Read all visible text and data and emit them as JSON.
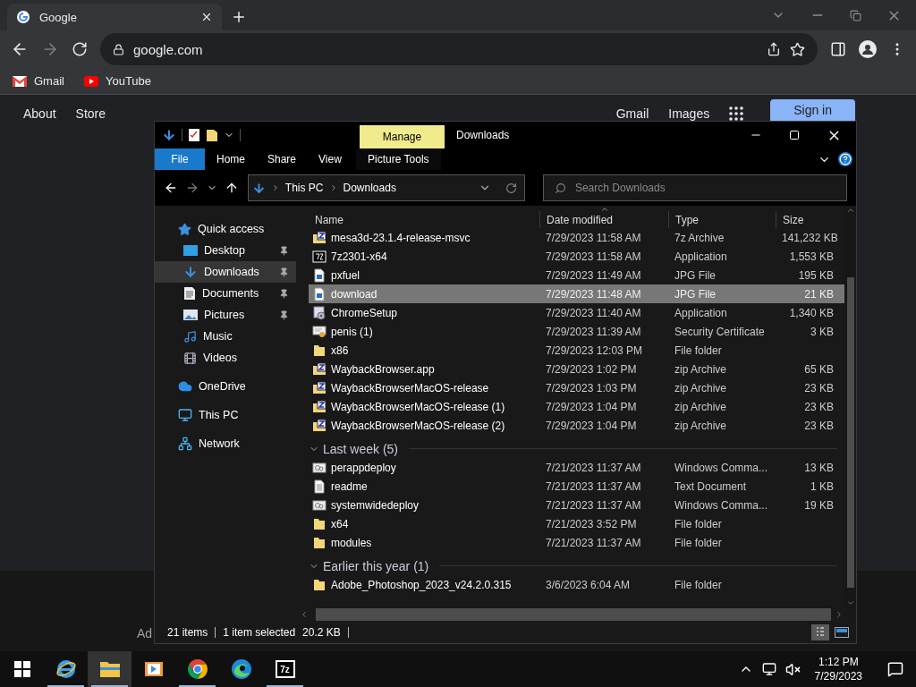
{
  "browser": {
    "tabs": [
      {
        "title": "Google",
        "selected": true
      }
    ],
    "forward_disabled": true,
    "address": "google.com",
    "bookmarks": [
      {
        "label": "Gmail",
        "kind": "gmail"
      },
      {
        "label": "YouTube",
        "kind": "youtube"
      }
    ]
  },
  "page": {
    "left_links": [
      "About",
      "Store"
    ],
    "right_links": [
      "Gmail",
      "Images"
    ],
    "sign_in": "Sign in",
    "footer_text": "Ad"
  },
  "explorer": {
    "title": "Downloads",
    "context_tab": "Manage",
    "ribbon_tabs": [
      {
        "label": "File",
        "kind": "file"
      },
      {
        "label": "Home",
        "kind": "tab"
      },
      {
        "label": "Share",
        "kind": "tab"
      },
      {
        "label": "View",
        "kind": "tab"
      },
      {
        "label": "Picture Tools",
        "kind": "contextual"
      }
    ],
    "forward_disabled": true,
    "breadcrumb": [
      "This PC",
      "Downloads"
    ],
    "search_placeholder": "Search Downloads",
    "nav": [
      {
        "label": "Quick access",
        "kind": "star",
        "selected": false,
        "children": [
          {
            "label": "Desktop",
            "kind": "desktop",
            "pinned": true,
            "selected": false
          },
          {
            "label": "Downloads",
            "kind": "download",
            "pinned": true,
            "selected": true
          },
          {
            "label": "Documents",
            "kind": "documents",
            "pinned": true,
            "selected": false
          },
          {
            "label": "Pictures",
            "kind": "pictures",
            "pinned": true,
            "selected": false
          },
          {
            "label": "Music",
            "kind": "music",
            "pinned": false,
            "selected": false
          },
          {
            "label": "Videos",
            "kind": "videos",
            "pinned": false,
            "selected": false
          }
        ]
      },
      {
        "label": "OneDrive",
        "kind": "cloud",
        "selected": false
      },
      {
        "label": "This PC",
        "kind": "pc",
        "selected": false
      },
      {
        "label": "Network",
        "kind": "network",
        "selected": false
      }
    ],
    "columns": [
      {
        "label": "Name",
        "sorted": false
      },
      {
        "label": "Date modified",
        "sorted": true
      },
      {
        "label": "Type",
        "sorted": false
      },
      {
        "label": "Size",
        "sorted": false
      }
    ],
    "groups": [
      {
        "rows": [
          {
            "name": "mesa3d-23.1.4-release-msvc",
            "date": "7/29/2023 11:58 AM",
            "type": "7z Archive",
            "size": "141,232 KB",
            "kind": "zip",
            "selected": false
          },
          {
            "name": "7z2301-x64",
            "date": "7/29/2023 11:58 AM",
            "type": "Application",
            "size": "1,553 KB",
            "kind": "sevenzip",
            "selected": false
          },
          {
            "name": "pxfuel",
            "date": "7/29/2023 11:49 AM",
            "type": "JPG File",
            "size": "195 KB",
            "kind": "image",
            "selected": false
          },
          {
            "name": "download",
            "date": "7/29/2023 11:48 AM",
            "type": "JPG File",
            "size": "21 KB",
            "kind": "image",
            "selected": true
          },
          {
            "name": "ChromeSetup",
            "date": "7/29/2023 11:40 AM",
            "type": "Application",
            "size": "1,340 KB",
            "kind": "installer",
            "selected": false
          },
          {
            "name": "penis (1)",
            "date": "7/29/2023 11:39 AM",
            "type": "Security Certificate",
            "size": "3 KB",
            "kind": "certificate",
            "selected": false
          },
          {
            "name": "x86",
            "date": "7/29/2023 12:03 PM",
            "type": "File folder",
            "kind": "folder",
            "selected": false
          },
          {
            "name": "WaybackBrowser.app",
            "date": "7/29/2023 1:02 PM",
            "type": "zip Archive",
            "size": "65 KB",
            "kind": "zip",
            "selected": false
          },
          {
            "name": "WaybackBrowserMacOS-release",
            "date": "7/29/2023 1:03 PM",
            "type": "zip Archive",
            "size": "23 KB",
            "kind": "zip",
            "selected": false
          },
          {
            "name": "WaybackBrowserMacOS-release (1)",
            "date": "7/29/2023 1:04 PM",
            "type": "zip Archive",
            "size": "23 KB",
            "kind": "zip",
            "selected": false
          },
          {
            "name": "WaybackBrowserMacOS-release (2)",
            "date": "7/29/2023 1:04 PM",
            "type": "zip Archive",
            "size": "23 KB",
            "kind": "zip",
            "selected": false
          }
        ]
      },
      {
        "title": "Last week (5)",
        "expanded": true,
        "rows": [
          {
            "name": "perappdeploy",
            "date": "7/21/2023 11:37 AM",
            "type": "Windows Comma...",
            "size": "13 KB",
            "kind": "script",
            "selected": false
          },
          {
            "name": "readme",
            "date": "7/21/2023 11:37 AM",
            "type": "Text Document",
            "size": "1 KB",
            "kind": "text",
            "selected": false
          },
          {
            "name": "systemwidedeploy",
            "date": "7/21/2023 11:37 AM",
            "type": "Windows Comma...",
            "size": "19 KB",
            "kind": "script",
            "selected": false
          },
          {
            "name": "x64",
            "date": "7/21/2023 3:52 PM",
            "type": "File folder",
            "kind": "folder",
            "selected": false
          },
          {
            "name": "modules",
            "date": "7/21/2023 11:37 AM",
            "type": "File folder",
            "kind": "folder",
            "selected": false
          }
        ]
      },
      {
        "title": "Earlier this year (1)",
        "expanded": true,
        "rows": [
          {
            "name": "Adobe_Photoshop_2023_v24.2.0.315",
            "date": "3/6/2023 6:04 AM",
            "type": "File folder",
            "kind": "folder",
            "selected": false
          }
        ]
      }
    ],
    "status": {
      "count": "21 items",
      "selection": "1 item selected",
      "size": "20.2 KB"
    },
    "views": [
      {
        "kind": "details",
        "selected": true
      },
      {
        "kind": "tiles",
        "selected": false
      }
    ]
  },
  "taskbar": {
    "apps": [
      {
        "kind": "ie",
        "running": true,
        "selected": false
      },
      {
        "kind": "explorer",
        "running": true,
        "selected": true
      },
      {
        "kind": "media",
        "running": false,
        "selected": false
      },
      {
        "kind": "chrome",
        "running": true,
        "selected": false
      },
      {
        "kind": "edge",
        "running": false,
        "selected": false
      },
      {
        "kind": "sevenzip",
        "label": "7z",
        "running": true,
        "selected": false
      }
    ],
    "time": "1:12 PM",
    "date": "7/29/2023"
  }
}
